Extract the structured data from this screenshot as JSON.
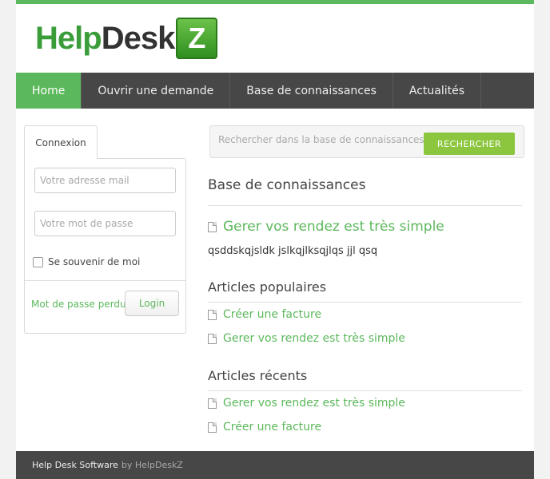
{
  "logo": {
    "help": "Help",
    "desk": "Desk",
    "z": "Z"
  },
  "nav": {
    "items": [
      "Home",
      "Ouvrir une demande",
      "Base de connaissances",
      "Actualités"
    ]
  },
  "login": {
    "tab": "Connexion",
    "email_placeholder": "Votre adresse mail",
    "password_placeholder": "Votre mot de passe",
    "remember": "Se souvenir de moi",
    "lost_password": "Mot de passe perdu",
    "login_button": "Login"
  },
  "search": {
    "placeholder": "Rechercher dans la base de connaissances",
    "button": "RECHERCHER"
  },
  "kb": {
    "title": "Base de connaissances",
    "featured_title": "Gerer vos rendez est très simple",
    "featured_desc": "qsddskqjsldk jslkqjlksqjlqs jjl qsq"
  },
  "popular": {
    "title": "Articles populaires",
    "items": [
      "Créer une facture",
      "Gerer vos rendez est très simple"
    ]
  },
  "recent": {
    "title": "Articles récents",
    "items": [
      "Gerer vos rendez est très simple",
      "Créer une facture"
    ]
  },
  "footer": {
    "main": "Help Desk Software",
    "sub": "by HelpDeskZ"
  }
}
